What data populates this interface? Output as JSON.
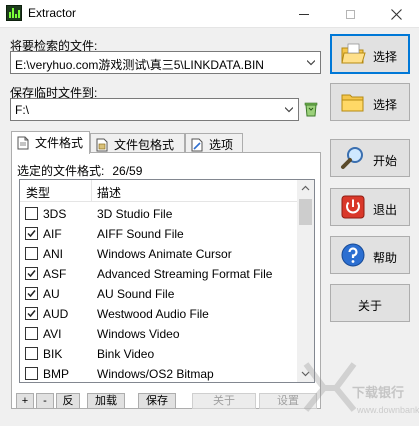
{
  "window": {
    "title": "Extractor"
  },
  "source": {
    "label": "将要检索的文件:",
    "value": "E:\\veryhuo.com游戏测试\\真三5\\LINKDATA.BIN"
  },
  "temp": {
    "label": "保存临时文件到:",
    "value": "F:\\"
  },
  "tabs": [
    {
      "label": "文件格式",
      "icon": "file-icon"
    },
    {
      "label": "文件包格式",
      "icon": "package-icon"
    },
    {
      "label": "选项",
      "icon": "options-icon"
    }
  ],
  "formats": {
    "selected_label": "选定的文件格式:",
    "selected_count": "26/59",
    "columns": {
      "type": "类型",
      "desc": "描述"
    },
    "rows": [
      {
        "code": "3DS",
        "desc": "3D Studio File",
        "checked": false
      },
      {
        "code": "AIF",
        "desc": "AIFF Sound File",
        "checked": true
      },
      {
        "code": "ANI",
        "desc": "Windows Animate Cursor",
        "checked": false
      },
      {
        "code": "ASF",
        "desc": "Advanced Streaming Format File",
        "checked": true
      },
      {
        "code": "AU",
        "desc": "AU Sound File",
        "checked": true
      },
      {
        "code": "AUD",
        "desc": "Westwood Audio File",
        "checked": true
      },
      {
        "code": "AVI",
        "desc": "Windows Video",
        "checked": false
      },
      {
        "code": "BIK",
        "desc": "Bink Video",
        "checked": false
      },
      {
        "code": "BMP",
        "desc": "Windows/OS2 Bitmap",
        "checked": false
      }
    ]
  },
  "bottom_buttons": {
    "plus": "+",
    "minus": "-",
    "invert": "反",
    "load": "加载",
    "save": "保存",
    "about": "关于",
    "reset": "设置"
  },
  "side_buttons": {
    "select1": "选择",
    "select2": "选择",
    "start": "开始",
    "exit": "退出",
    "help": "帮助",
    "about": "关于"
  },
  "watermark": {
    "text": "下载银行",
    "url": "www.downbank.cn"
  }
}
